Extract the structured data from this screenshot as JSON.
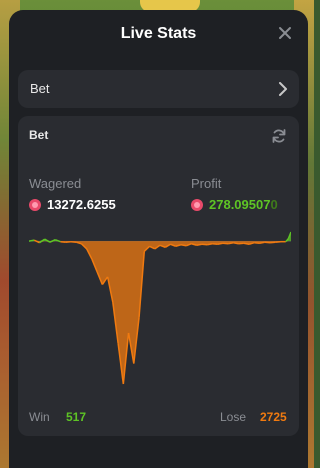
{
  "panel": {
    "title": "Live Stats",
    "close_icon": "close-icon"
  },
  "bet_selector": {
    "label": "Bet",
    "icon": "chevron-right-icon"
  },
  "stats_card": {
    "title": "Bet",
    "refresh_icon": "refresh-icon",
    "wagered_label": "Wagered",
    "wagered_value": "13272.6255",
    "profit_label": "Profit",
    "profit_value": "278.09507",
    "profit_value_tail": "0",
    "currency_icon": "tron-coin-icon",
    "win_label": "Win",
    "win_value": "517",
    "lose_label": "Lose",
    "lose_value": "2725"
  },
  "colors": {
    "profit_green": "#5ec425",
    "loss_orange": "#f07a10",
    "win_green": "#5ec425",
    "lose_orange": "#f07a10"
  },
  "chart_data": {
    "type": "area",
    "x": [
      0,
      2,
      4,
      6,
      8,
      10,
      12,
      14,
      16,
      18,
      20,
      22,
      24,
      26,
      28,
      30,
      32,
      34,
      36,
      38,
      40,
      42,
      44,
      46,
      48,
      50,
      52,
      54,
      56,
      58,
      60,
      62,
      64,
      66,
      68,
      70,
      72,
      74,
      76,
      78,
      80,
      82,
      84,
      86,
      88,
      90,
      92,
      94,
      96,
      98,
      99,
      100
    ],
    "values": [
      0,
      2,
      -3,
      4,
      -2,
      3,
      -1,
      -2,
      -1,
      -2,
      -5,
      -15,
      -35,
      -60,
      -85,
      -70,
      -120,
      -200,
      -280,
      -180,
      -240,
      -150,
      -20,
      -10,
      -15,
      -8,
      -12,
      -6,
      -10,
      -7,
      -9,
      -5,
      -8,
      -6,
      -7,
      -5,
      -6,
      -4,
      -5,
      -3,
      -5,
      -4,
      -6,
      -3,
      -4,
      -2,
      -3,
      -2,
      -1,
      -1,
      5,
      18
    ]
  }
}
